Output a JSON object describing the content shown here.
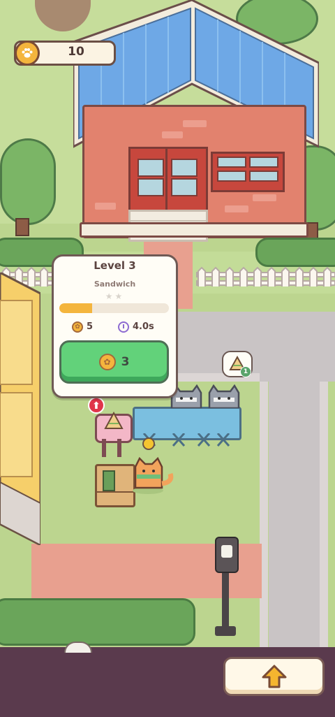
{
  "hud": {
    "coin_count": "10",
    "coin_icon": "paw-coin-icon"
  },
  "popup": {
    "level_label": "Level 3",
    "item_name": "Sandwich",
    "stars_filled": 0,
    "stars_total": 2,
    "progress": 0.3,
    "earn_value": "5",
    "time_value": "4.0s",
    "upgrade_cost": "3"
  },
  "order_bubble": {
    "item_icon": "sandwich-icon",
    "count_badge": "1"
  },
  "bottom_bar": {
    "action_icon": "up-arrow-icon"
  },
  "colors": {
    "button_green": "#62d27a",
    "progress_fill": "#f4b53d",
    "coin_gold": "#f4b53d",
    "bottom_bar": "#5a3a4d",
    "roof_blue": "#6ea8e6"
  }
}
